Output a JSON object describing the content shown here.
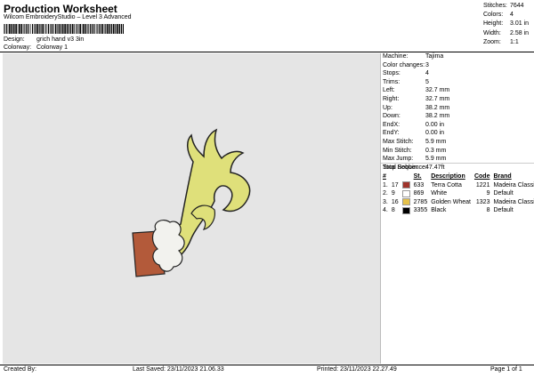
{
  "header": {
    "title": "Production Worksheet",
    "subtitle": "Wilcom EmbroideryStudio – Level 3 Advanced"
  },
  "design": {
    "label": "Design:",
    "value": "grich hand v3 3in"
  },
  "colorway": {
    "label": "Colorway:",
    "value": "Colorway 1"
  },
  "stats": [
    {
      "label": "Stitches:",
      "value": "7644"
    },
    {
      "label": "Colors:",
      "value": "4"
    },
    {
      "label": "Height:",
      "value": "3.01 in"
    },
    {
      "label": "Width:",
      "value": "2.58 in"
    },
    {
      "label": "Zoom:",
      "value": "1:1"
    }
  ],
  "info": [
    {
      "label": "Machine:",
      "value": "Tajima"
    },
    {
      "label": "Color changes:",
      "value": "3"
    },
    {
      "label": "Stops:",
      "value": "4"
    },
    {
      "label": "Trims:",
      "value": "5"
    },
    {
      "label": "Left:",
      "value": "32.7 mm"
    },
    {
      "label": "Right:",
      "value": "32.7 mm"
    },
    {
      "label": "Up:",
      "value": "38.2 mm"
    },
    {
      "label": "Down:",
      "value": "38.2 mm"
    },
    {
      "label": "EndX:",
      "value": "0.00 in"
    },
    {
      "label": "EndY:",
      "value": "0.00 in"
    },
    {
      "label": "Max Stitch:",
      "value": "5.9 mm"
    },
    {
      "label": "Min Stitch:",
      "value": "0.3 mm"
    },
    {
      "label": "Max Jump:",
      "value": "5.9 mm"
    },
    {
      "label": "Total Bobbin:",
      "value": "47.47ft"
    }
  ],
  "sequence": {
    "title": "Stop Sequence:",
    "headers": {
      "n": "#",
      "st": "St.",
      "description": "Description",
      "code": "Code",
      "brand": "Brand"
    },
    "rows": [
      {
        "idx": "1.",
        "n": "17",
        "color": "#a0342c",
        "st": "633",
        "description": "Terra Cotta",
        "code": "1221",
        "brand": "Madeira Classic 40"
      },
      {
        "idx": "2.",
        "n": "9",
        "color": "#ffffff",
        "st": "869",
        "description": "White",
        "code": "9",
        "brand": "Default"
      },
      {
        "idx": "3.",
        "n": "16",
        "color": "#e6c24a",
        "st": "2785",
        "description": "Golden Wheat",
        "code": "1323",
        "brand": "Madeira Classic 40"
      },
      {
        "idx": "4.",
        "n": "8",
        "color": "#000000",
        "st": "3355",
        "description": "Black",
        "code": "8",
        "brand": "Default"
      }
    ]
  },
  "footer": {
    "created": "Created By:",
    "saved": "Last Saved: 23/11/2023 21.06.33",
    "printed": "Printed: 23/11/2023 22.27.49",
    "page": "Page 1 of 1"
  },
  "colors": {
    "canvas": "#e5e5e5",
    "hand": "#dfe07a",
    "sleeve": "#b35a3a",
    "cuff": "#f2f2ee"
  }
}
